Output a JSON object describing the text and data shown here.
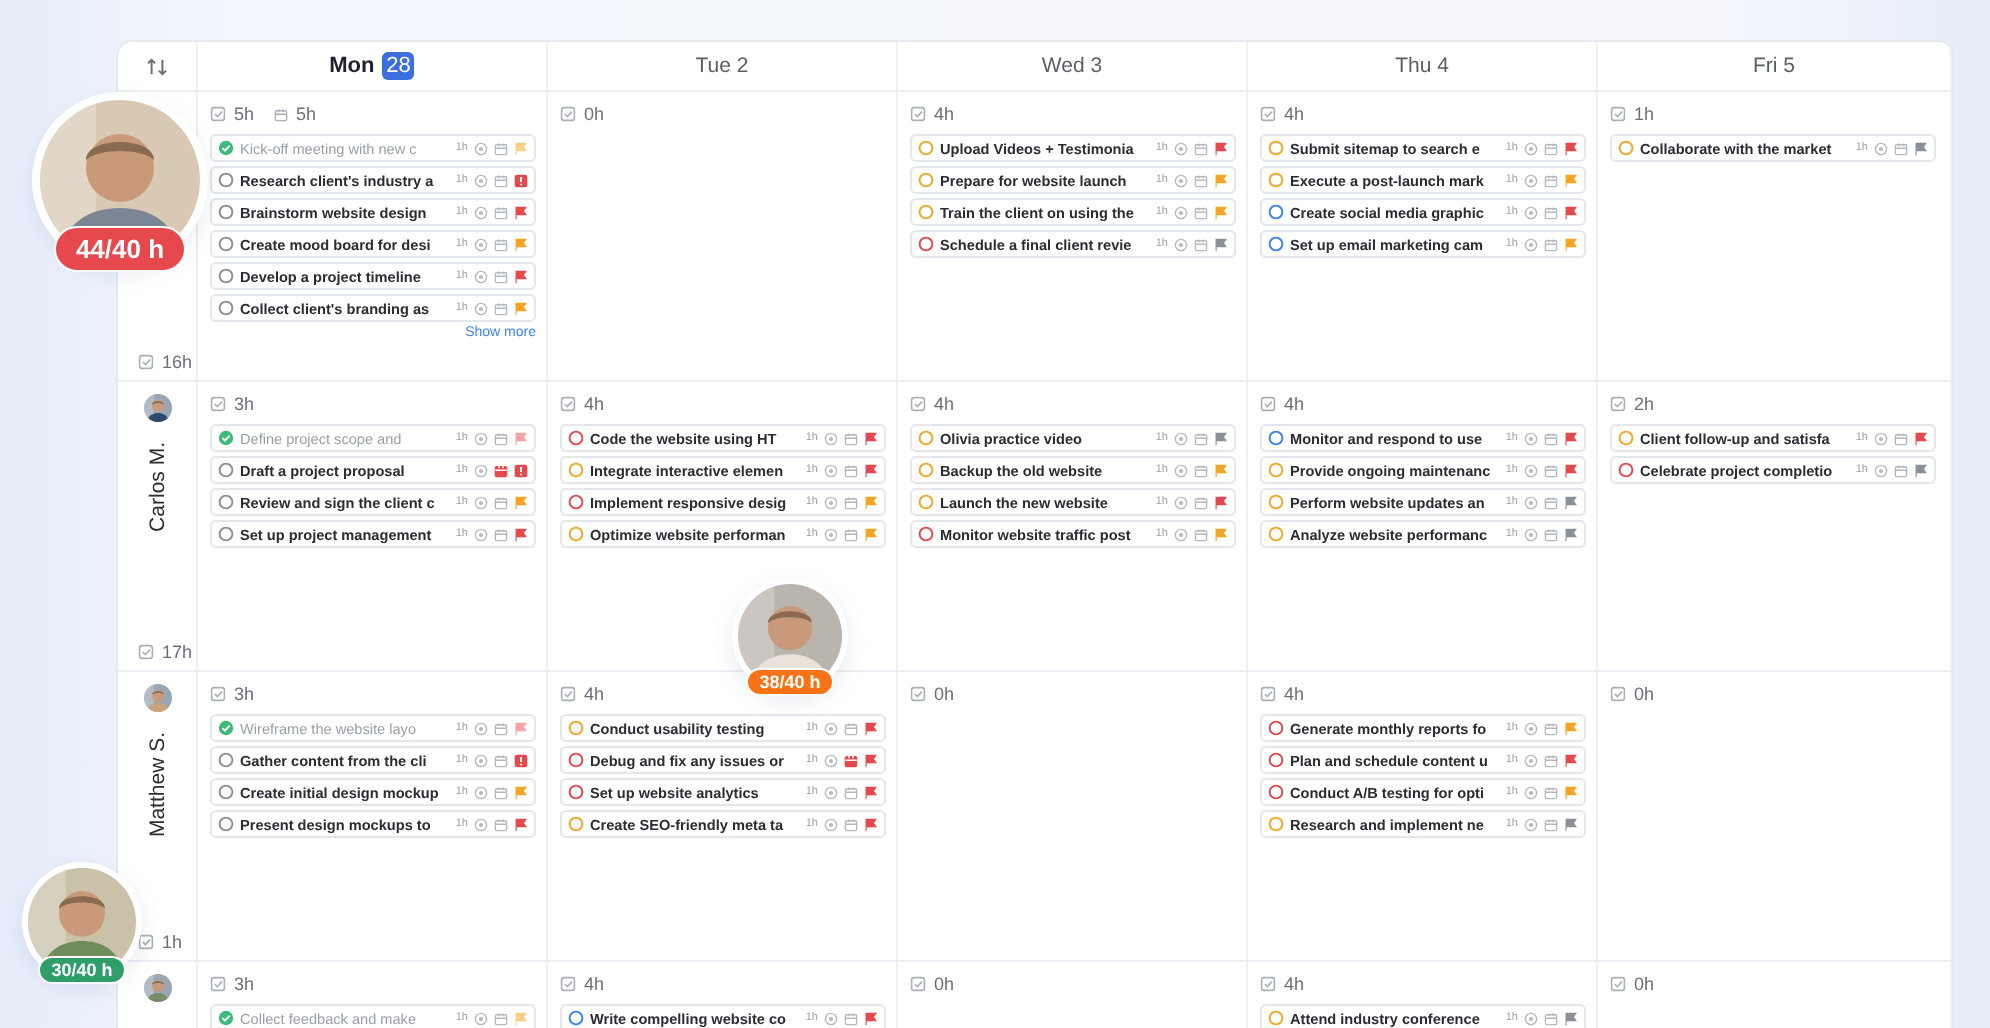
{
  "days": [
    {
      "name": "Mon",
      "date": "28",
      "today": true
    },
    {
      "name": "Tue",
      "date": "2",
      "today": false
    },
    {
      "name": "Wed",
      "date": "3",
      "today": false
    },
    {
      "name": "Thu",
      "date": "4",
      "today": false
    },
    {
      "name": "Fri",
      "date": "5",
      "today": false
    }
  ],
  "rows": [
    {
      "total": "16h",
      "cells": [
        {
          "hours": "5h",
          "scheduled": "5h",
          "show_more": "Show more",
          "tasks": [
            {
              "title": "Kick-off meeting with new c",
              "done": true,
              "color": "#3dbb7a",
              "duration": "1h",
              "flag": {
                "kind": "flag",
                "color": "#f9cf86"
              },
              "overdue": false
            },
            {
              "title": "Research client's industry a",
              "done": false,
              "color": "#8a8f98",
              "duration": "1h",
              "flag": {
                "kind": "alert",
                "color": "#e5484d"
              },
              "overdue": false
            },
            {
              "title": "Brainstorm website design",
              "done": false,
              "color": "#8a8f98",
              "duration": "1h",
              "flag": {
                "kind": "flag",
                "color": "#e5484d"
              },
              "overdue": false
            },
            {
              "title": "Create mood board for desi",
              "done": false,
              "color": "#8a8f98",
              "duration": "1h",
              "flag": {
                "kind": "flag",
                "color": "#f5a524"
              },
              "overdue": false
            },
            {
              "title": "Develop a project timeline",
              "done": false,
              "color": "#8a8f98",
              "duration": "1h",
              "flag": {
                "kind": "flag",
                "color": "#e5484d"
              },
              "overdue": false
            },
            {
              "title": "Collect client's branding as",
              "done": false,
              "color": "#8a8f98",
              "duration": "1h",
              "flag": {
                "kind": "flag",
                "color": "#f5a524"
              },
              "overdue": false
            }
          ]
        },
        {
          "hours": "0h"
        },
        {
          "hours": "4h",
          "tasks": [
            {
              "title": "Upload Videos + Testimonia",
              "done": false,
              "color": "#f5a524",
              "duration": "1h",
              "flag": {
                "kind": "flag",
                "color": "#e5484d"
              },
              "overdue": false
            },
            {
              "title": "Prepare for website launch",
              "done": false,
              "color": "#f5a524",
              "duration": "1h",
              "flag": {
                "kind": "flag",
                "color": "#f5a524"
              },
              "overdue": false
            },
            {
              "title": "Train the client on using the",
              "done": false,
              "color": "#f5a524",
              "duration": "1h",
              "flag": {
                "kind": "flag",
                "color": "#f5a524"
              },
              "overdue": false
            },
            {
              "title": "Schedule a final client revie",
              "done": false,
              "color": "#e5484d",
              "duration": "1h",
              "flag": {
                "kind": "flag",
                "color": "#8a8f98"
              },
              "overdue": false
            }
          ]
        },
        {
          "hours": "4h",
          "tasks": [
            {
              "title": "Submit sitemap to search e",
              "done": false,
              "color": "#f5a524",
              "duration": "1h",
              "flag": {
                "kind": "flag",
                "color": "#e5484d"
              },
              "overdue": false
            },
            {
              "title": "Execute a post-launch mark",
              "done": false,
              "color": "#f5a524",
              "duration": "1h",
              "flag": {
                "kind": "flag",
                "color": "#f5a524"
              },
              "overdue": false
            },
            {
              "title": "Create social media graphic",
              "done": false,
              "color": "#3b82f6",
              "duration": "1h",
              "flag": {
                "kind": "flag",
                "color": "#e5484d"
              },
              "overdue": false
            },
            {
              "title": "Set up email marketing cam",
              "done": false,
              "color": "#3b82f6",
              "duration": "1h",
              "flag": {
                "kind": "flag",
                "color": "#f5a524"
              },
              "overdue": false
            }
          ]
        },
        {
          "hours": "1h",
          "tasks": [
            {
              "title": "Collaborate with the market",
              "done": false,
              "color": "#f5a524",
              "duration": "1h",
              "flag": {
                "kind": "flag",
                "color": "#8a8f98"
              },
              "overdue": false
            }
          ]
        }
      ]
    },
    {
      "name": "Carlos M.",
      "total": "17h",
      "cells": [
        {
          "hours": "3h",
          "tasks": [
            {
              "title": "Define project scope and",
              "done": true,
              "color": "#3dbb7a",
              "duration": "1h",
              "flag": {
                "kind": "flag",
                "color": "#f4a3a6"
              },
              "overdue": false
            },
            {
              "title": "Draft a project proposal",
              "done": false,
              "color": "#8a8f98",
              "duration": "1h",
              "flag": {
                "kind": "alert",
                "color": "#e5484d"
              },
              "overdue": true
            },
            {
              "title": "Review and sign the client c",
              "done": false,
              "color": "#8a8f98",
              "duration": "1h",
              "flag": {
                "kind": "flag",
                "color": "#f5a524"
              },
              "overdue": false
            },
            {
              "title": "Set up project management",
              "done": false,
              "color": "#8a8f98",
              "duration": "1h",
              "flag": {
                "kind": "flag",
                "color": "#e5484d"
              },
              "overdue": false
            }
          ]
        },
        {
          "hours": "4h",
          "tasks": [
            {
              "title": "Code the website using HT",
              "done": false,
              "color": "#e5484d",
              "duration": "1h",
              "flag": {
                "kind": "flag",
                "color": "#e5484d"
              },
              "overdue": false
            },
            {
              "title": "Integrate interactive elemen",
              "done": false,
              "color": "#f5a524",
              "duration": "1h",
              "flag": {
                "kind": "flag",
                "color": "#e5484d"
              },
              "overdue": false
            },
            {
              "title": "Implement responsive desig",
              "done": false,
              "color": "#e5484d",
              "duration": "1h",
              "flag": {
                "kind": "flag",
                "color": "#f5a524"
              },
              "overdue": false
            },
            {
              "title": "Optimize website performan",
              "done": false,
              "color": "#f5a524",
              "duration": "1h",
              "flag": {
                "kind": "flag",
                "color": "#f5a524"
              },
              "overdue": false
            }
          ]
        },
        {
          "hours": "4h",
          "tasks": [
            {
              "title": "Olivia practice video",
              "done": false,
              "color": "#f5a524",
              "duration": "1h",
              "flag": {
                "kind": "flag",
                "color": "#8a8f98"
              },
              "overdue": false
            },
            {
              "title": "Backup the old website",
              "done": false,
              "color": "#f5a524",
              "duration": "1h",
              "flag": {
                "kind": "flag",
                "color": "#f5a524"
              },
              "overdue": false
            },
            {
              "title": "Launch the new website",
              "done": false,
              "color": "#f5a524",
              "duration": "1h",
              "flag": {
                "kind": "flag",
                "color": "#e5484d"
              },
              "overdue": false
            },
            {
              "title": "Monitor website traffic post",
              "done": false,
              "color": "#e5484d",
              "duration": "1h",
              "flag": {
                "kind": "flag",
                "color": "#f5a524"
              },
              "overdue": false
            }
          ]
        },
        {
          "hours": "4h",
          "tasks": [
            {
              "title": "Monitor and respond to use",
              "done": false,
              "color": "#3b82f6",
              "duration": "1h",
              "flag": {
                "kind": "flag",
                "color": "#e5484d"
              },
              "overdue": false
            },
            {
              "title": "Provide ongoing maintenanc",
              "done": false,
              "color": "#f5a524",
              "duration": "1h",
              "flag": {
                "kind": "flag",
                "color": "#e5484d"
              },
              "overdue": false
            },
            {
              "title": "Perform website updates an",
              "done": false,
              "color": "#f5a524",
              "duration": "1h",
              "flag": {
                "kind": "flag",
                "color": "#8a8f98"
              },
              "overdue": false
            },
            {
              "title": "Analyze website performanc",
              "done": false,
              "color": "#f5a524",
              "duration": "1h",
              "flag": {
                "kind": "flag",
                "color": "#8a8f98"
              },
              "overdue": false
            }
          ]
        },
        {
          "hours": "2h",
          "tasks": [
            {
              "title": "Client follow-up and satisfa",
              "done": false,
              "color": "#f5a524",
              "duration": "1h",
              "flag": {
                "kind": "flag",
                "color": "#e5484d"
              },
              "overdue": false
            },
            {
              "title": "Celebrate project completio",
              "done": false,
              "color": "#e5484d",
              "duration": "1h",
              "flag": {
                "kind": "flag",
                "color": "#8a8f98"
              },
              "overdue": false
            }
          ]
        }
      ]
    },
    {
      "name": "Matthew S.",
      "total": "1h",
      "cells": [
        {
          "hours": "3h",
          "tasks": [
            {
              "title": "Wireframe the website layo",
              "done": true,
              "color": "#3dbb7a",
              "duration": "1h",
              "flag": {
                "kind": "flag",
                "color": "#f4a3a6"
              },
              "overdue": false
            },
            {
              "title": "Gather content from the cli",
              "done": false,
              "color": "#8a8f98",
              "duration": "1h",
              "flag": {
                "kind": "alert",
                "color": "#e5484d"
              },
              "overdue": false
            },
            {
              "title": "Create initial design mockup",
              "done": false,
              "color": "#8a8f98",
              "duration": "1h",
              "flag": {
                "kind": "flag",
                "color": "#f5a524"
              },
              "overdue": false
            },
            {
              "title": "Present design mockups to",
              "done": false,
              "color": "#8a8f98",
              "duration": "1h",
              "flag": {
                "kind": "flag",
                "color": "#e5484d"
              },
              "overdue": false
            }
          ]
        },
        {
          "hours": "4h",
          "tasks": [
            {
              "title": "Conduct usability testing",
              "done": false,
              "color": "#f5a524",
              "duration": "1h",
              "flag": {
                "kind": "flag",
                "color": "#e5484d"
              },
              "overdue": false
            },
            {
              "title": "Debug and fix any issues or",
              "done": false,
              "color": "#e5484d",
              "duration": "1h",
              "flag": {
                "kind": "flag",
                "color": "#e5484d"
              },
              "overdue": true
            },
            {
              "title": "Set up website analytics",
              "done": false,
              "color": "#e5484d",
              "duration": "1h",
              "flag": {
                "kind": "flag",
                "color": "#e5484d"
              },
              "overdue": false
            },
            {
              "title": "Create SEO-friendly meta ta",
              "done": false,
              "color": "#f5a524",
              "duration": "1h",
              "flag": {
                "kind": "flag",
                "color": "#e5484d"
              },
              "overdue": false
            }
          ]
        },
        {
          "hours": "0h"
        },
        {
          "hours": "4h",
          "tasks": [
            {
              "title": "Generate monthly reports fo",
              "done": false,
              "color": "#e5484d",
              "duration": "1h",
              "flag": {
                "kind": "flag",
                "color": "#f5a524"
              },
              "overdue": false
            },
            {
              "title": "Plan and schedule content u",
              "done": false,
              "color": "#e5484d",
              "duration": "1h",
              "flag": {
                "kind": "flag",
                "color": "#e5484d"
              },
              "overdue": false
            },
            {
              "title": "Conduct A/B testing for opti",
              "done": false,
              "color": "#e5484d",
              "duration": "1h",
              "flag": {
                "kind": "flag",
                "color": "#f5a524"
              },
              "overdue": false
            },
            {
              "title": "Research and implement ne",
              "done": false,
              "color": "#f5a524",
              "duration": "1h",
              "flag": {
                "kind": "flag",
                "color": "#8a8f98"
              },
              "overdue": false
            }
          ]
        },
        {
          "hours": "0h"
        }
      ]
    },
    {
      "cells": [
        {
          "hours": "3h",
          "tasks": [
            {
              "title": "Collect feedback and make",
              "done": true,
              "color": "#3dbb7a",
              "duration": "1h",
              "flag": {
                "kind": "flag",
                "color": "#f9cf86"
              },
              "overdue": false
            }
          ]
        },
        {
          "hours": "4h",
          "tasks": [
            {
              "title": "Write compelling website co",
              "done": false,
              "color": "#3b82f6",
              "duration": "1h",
              "flag": {
                "kind": "flag",
                "color": "#e5484d"
              },
              "overdue": false
            }
          ]
        },
        {
          "hours": "0h"
        },
        {
          "hours": "4h",
          "tasks": [
            {
              "title": "Attend industry conference",
              "done": false,
              "color": "#f5a524",
              "duration": "1h",
              "flag": {
                "kind": "flag",
                "color": "#8a8f98"
              },
              "overdue": false
            }
          ]
        },
        {
          "hours": "0h"
        }
      ]
    }
  ],
  "workload": [
    {
      "label": "44/40 h",
      "color": "#e5484d"
    },
    {
      "label": "38/40 h",
      "color": "#f97316"
    },
    {
      "label": "30/40 h",
      "color": "#2f9e6a"
    }
  ]
}
